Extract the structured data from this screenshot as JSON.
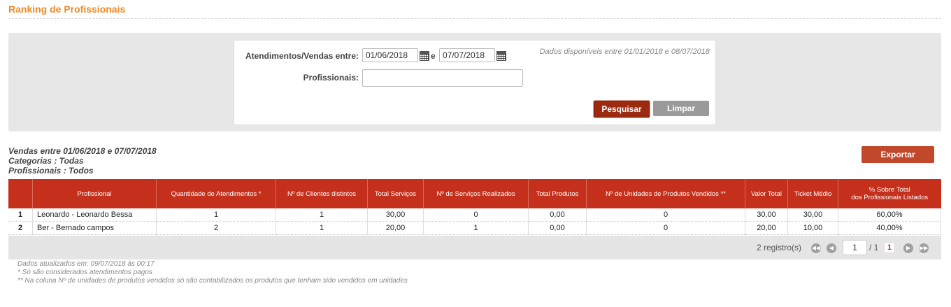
{
  "page": {
    "title": "Ranking de Profissionais"
  },
  "filters": {
    "period_label": "Atendimentos/Vendas entre:",
    "date_from": "01/06/2018",
    "date_separator": "e",
    "date_to": "07/07/2018",
    "professionals_label": "Profissionais:",
    "professionals_value": "",
    "availability_note": "Dados disponíveis entre 01/01/2018 e 08/07/2018",
    "search_button": "Pesquisar",
    "clear_button": "Limpar"
  },
  "summary": {
    "line1": "Vendas entre 01/06/2018 e 07/07/2018",
    "line2": "Categorias : Todas",
    "line3": "Profissionais : Todos"
  },
  "export_button": "Exportar",
  "table": {
    "columns": [
      "",
      "Profissional",
      "Quantidade de Atendimentos *",
      "Nº de Clientes distintos",
      "Total Serviços",
      "Nº de Serviços Realizados",
      "Total Produtos",
      "Nº de Unidades de Produtos Vendidos **",
      "Valor Total",
      "Ticket Médio",
      "% Sobre Total\ndos Profissionais Listados"
    ],
    "rows": [
      [
        "1",
        "Leonardo - Leonardo Bessa",
        "1",
        "1",
        "30,00",
        "0",
        "0,00",
        "0",
        "30,00",
        "30,00",
        "60,00%"
      ],
      [
        "2",
        "Ber - Bernado campos",
        "2",
        "1",
        "20,00",
        "1",
        "0,00",
        "0",
        "20,00",
        "10,00",
        "40,00%"
      ]
    ]
  },
  "pager": {
    "record_count": "2 registro(s)",
    "page_input": "1",
    "page_total": "/ 1",
    "current_page": "1"
  },
  "footnotes": {
    "updated": "Dados atualizados em: 09/07/2018 às 00:17",
    "note1": "* Só são considerados atendimentos pagos",
    "note2": "** Na coluna Nº de unidades de produtos vendidos só são contabilizados os produtos que tenham sido vendidos em unidades"
  },
  "colors": {
    "title": "#f08a24",
    "table_header": "#c4301c",
    "search_button": "#9b2a10",
    "export_button": "#c2482c"
  }
}
